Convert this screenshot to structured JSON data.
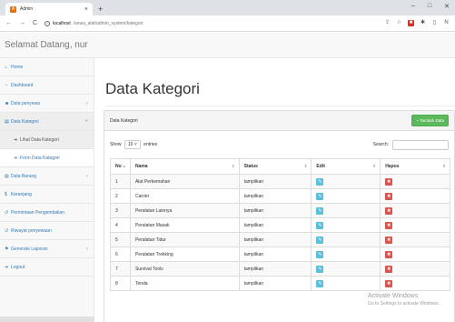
{
  "browser": {
    "tab_title": "Admin",
    "favicon_letter": "A",
    "new_tab": "+",
    "url_host": "localhost",
    "url_path": "/sewa_alat/admin_system/kategori",
    "window_controls": [
      "–",
      "□",
      "✕"
    ]
  },
  "header": {
    "brand": "Selamat Datang, nur"
  },
  "sidebar": {
    "items": [
      {
        "icon": "home-icon",
        "label": "Home"
      },
      {
        "icon": "dashboard-icon",
        "label": "Dashboard"
      },
      {
        "icon": "users-icon",
        "label": "Data penyewa"
      },
      {
        "icon": "list-icon",
        "label": "Data Kategori"
      },
      {
        "label": "Lihat Data Kategori"
      },
      {
        "label": "Form Data Kategori"
      },
      {
        "icon": "list-icon",
        "label": "Data Barang"
      },
      {
        "icon": "dollar-icon",
        "label": "Keranjang"
      },
      {
        "icon": "history-icon",
        "label": "Permintaan Pengembalian"
      },
      {
        "icon": "history-icon",
        "label": "Riwayat penyewaan"
      },
      {
        "icon": "report-icon",
        "label": "Generate Laporan"
      },
      {
        "icon": "logout-icon",
        "label": "Logout"
      }
    ]
  },
  "main": {
    "page_title": "Data Kategori",
    "panel_title": "Data Kategori",
    "add_button": "+ Tambah Data",
    "show_label": "Show",
    "show_value": "10",
    "entries_label": "entries",
    "search_label": "Search:",
    "table": {
      "headers": [
        "No",
        "Nama",
        "Status",
        "Edit",
        "Hapus"
      ],
      "rows": [
        {
          "no": "1",
          "nama": "Alat Perkemahan",
          "status": "tampilkan"
        },
        {
          "no": "2",
          "nama": "Carrier",
          "status": "tampilkan"
        },
        {
          "no": "3",
          "nama": "Peralatan Lainnya",
          "status": "tampilkan"
        },
        {
          "no": "4",
          "nama": "Peralatan Masak",
          "status": "tampilkan"
        },
        {
          "no": "5",
          "nama": "Peralatan Tidur",
          "status": "tampilkan"
        },
        {
          "no": "6",
          "nama": "Peralatan Trekking",
          "status": "tampilkan"
        },
        {
          "no": "7",
          "nama": "Survival Tools",
          "status": "tampilkan"
        },
        {
          "no": "8",
          "nama": "Tenda",
          "status": "tampilkan"
        }
      ]
    }
  },
  "watermark": {
    "title": "Activate Windows",
    "subtitle": "Go to Settings to activate Windows."
  },
  "colors": {
    "link": "#337ab7",
    "success": "#5cb85c",
    "info": "#5bc0de",
    "danger": "#d9534f"
  }
}
